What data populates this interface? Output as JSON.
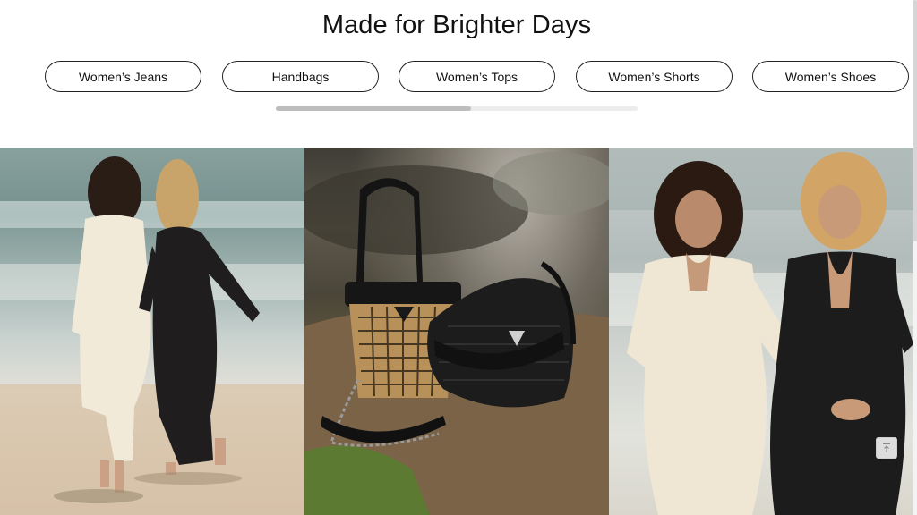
{
  "section": {
    "headline": "Made for Brighter Days"
  },
  "categories": [
    {
      "label": "Women’s Jeans"
    },
    {
      "label": "Handbags"
    },
    {
      "label": "Women’s Tops"
    },
    {
      "label": "Women’s Shorts"
    },
    {
      "label": "Women’s Shoes"
    }
  ],
  "carousel": {
    "scroll_progress": 0.54
  },
  "gallery": [
    {
      "name": "beach-back-view-photo"
    },
    {
      "name": "handbags-on-rock-photo"
    },
    {
      "name": "women-laughing-beach-photo"
    }
  ],
  "icons": {
    "back_to_top": "arrow-up-to-line-icon"
  },
  "colors": {
    "text": "#111111",
    "pill_border": "#222222",
    "scroll_track": "#ececec",
    "scroll_thumb": "#bdbdbd"
  }
}
